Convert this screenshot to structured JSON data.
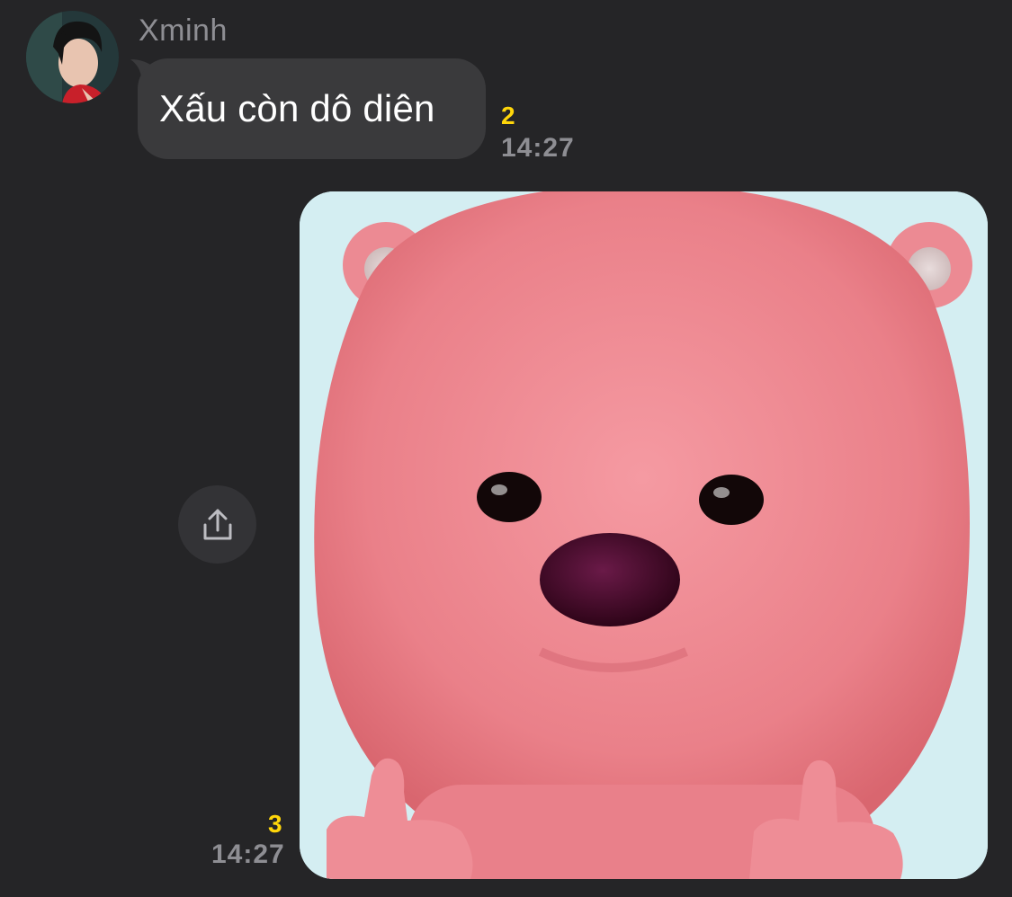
{
  "conversation": {
    "sender": {
      "name": "Xminh",
      "avatar_icon": "profile-photo"
    },
    "messages": [
      {
        "type": "text",
        "text": "Xấu còn dô diên",
        "reaction_count": "2",
        "time": "14:27"
      },
      {
        "type": "sticker",
        "image_icon": "pink-beaver-sticker",
        "reaction_count": "3",
        "time": "14:27"
      }
    ],
    "share_icon": "share-upload-icon"
  },
  "colors": {
    "background": "#252527",
    "bubble": "#3a3a3c",
    "reaction_accent": "#ffd60a",
    "muted_text": "#8e8e93"
  }
}
